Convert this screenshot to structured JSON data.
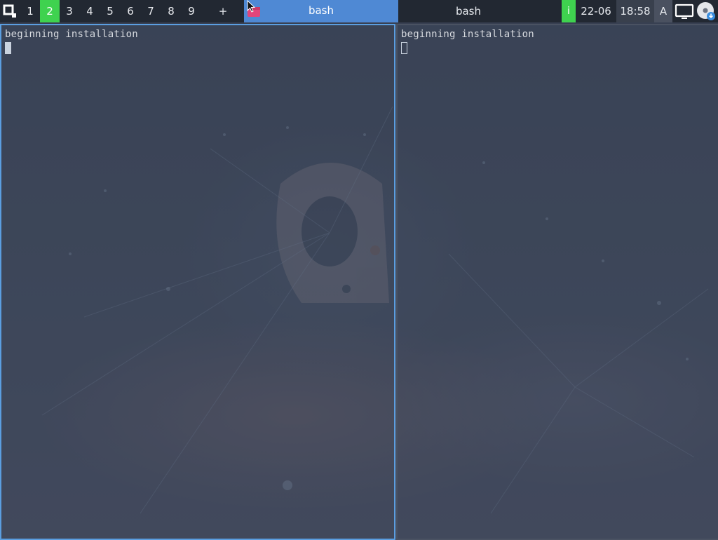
{
  "taskbar": {
    "workspaces": [
      {
        "label": "1",
        "active": false
      },
      {
        "label": "2",
        "active": true
      },
      {
        "label": "3",
        "active": false
      },
      {
        "label": "4",
        "active": false
      },
      {
        "label": "5",
        "active": false
      },
      {
        "label": "6",
        "active": false
      },
      {
        "label": "7",
        "active": false
      },
      {
        "label": "8",
        "active": false
      },
      {
        "label": "9",
        "active": false
      }
    ],
    "add_workspace_label": "+",
    "tasks": [
      {
        "title": "bash",
        "active": true
      },
      {
        "title": "bash",
        "active": false
      }
    ],
    "info_label": "i",
    "date": "22-06",
    "time": "18:58",
    "keyboard_layout": "A",
    "icons": [
      "app-menu-icon",
      "terminal-app-icon",
      "display-icon",
      "disc-update-icon"
    ]
  },
  "terminals": [
    {
      "output": "beginning installation",
      "focused": true
    },
    {
      "output": "beginning installation",
      "focused": false
    }
  ],
  "colors": {
    "accent_green": "#3fd24f",
    "active_task_blue": "#4f89d4",
    "focused_border": "#5b9ee0",
    "panel_bg": "#222832"
  }
}
